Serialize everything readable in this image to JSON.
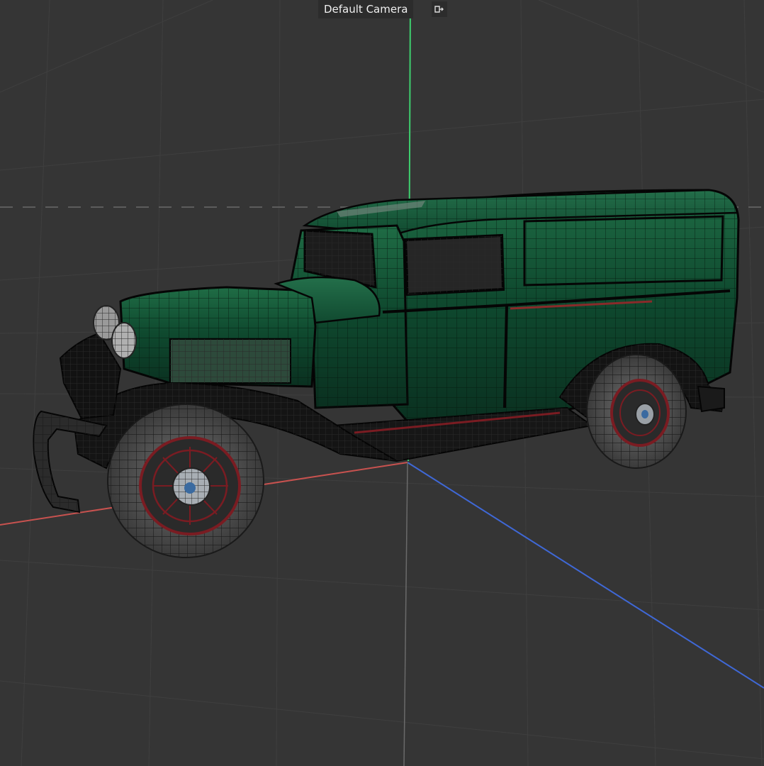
{
  "viewport": {
    "camera_label": "Default Camera",
    "camera_menu_icon": "camera-switch-icon",
    "background": "#353535",
    "grid_color": "#3e3e3e",
    "axis_colors": {
      "x": "#c8524f",
      "y": "#3ecf6e",
      "z": "#3f68d6"
    }
  },
  "model": {
    "body_color": "#0f4a2f",
    "body_highlight": "#1f6d45",
    "chassis_color": "#111111",
    "wheel_rim_color": "#7a1c22",
    "tire_color": "#3b3b3b",
    "wire_color": "#0a0a0a"
  }
}
